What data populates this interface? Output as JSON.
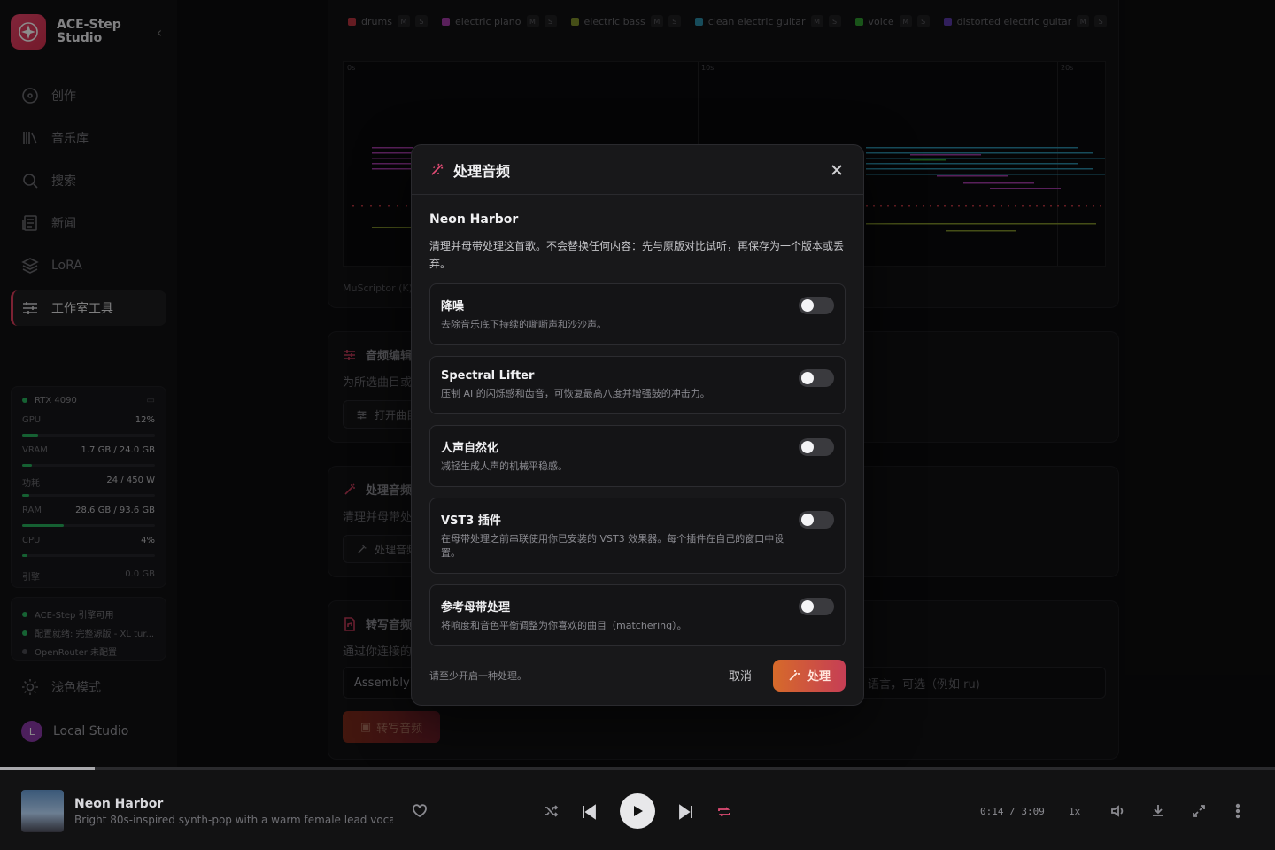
{
  "app": {
    "brand_line1": "ACE-Step",
    "brand_line2": "Studio"
  },
  "nav": [
    {
      "label": "创作",
      "icon": "disc-icon"
    },
    {
      "label": "音乐库",
      "icon": "library-icon"
    },
    {
      "label": "搜索",
      "icon": "search-icon"
    },
    {
      "label": "新闻",
      "icon": "news-icon"
    },
    {
      "label": "LoRA",
      "icon": "layers-icon"
    },
    {
      "label": "工作室工具",
      "icon": "sliders-icon",
      "active": true
    }
  ],
  "hardware": {
    "device": "RTX 4090",
    "rows": [
      {
        "label": "GPU",
        "value": "12%",
        "fill": 0.12
      },
      {
        "label": "VRAM",
        "value": "1.7 GB / 24.0 GB",
        "fill": 0.07
      },
      {
        "label": "功耗",
        "value": "24 / 450 W",
        "fill": 0.05
      },
      {
        "label": "RAM",
        "value": "28.6 GB / 93.6 GB",
        "fill": 0.31
      },
      {
        "label": "CPU",
        "value": "4%",
        "fill": 0.04
      }
    ],
    "engine_label": "引擎",
    "engine_value": "0.0 GB"
  },
  "status": [
    {
      "text": "ACE-Step 引擎可用",
      "ok": true
    },
    {
      "text": "配置就绪: 完整源版 - XL tur...",
      "ok": true
    },
    {
      "text": "OpenRouter 未配置",
      "ok": false
    }
  ],
  "theme_label": "浅色模式",
  "user": {
    "initial": "L",
    "name": "Local Studio"
  },
  "midi": {
    "legend": [
      {
        "name": "drums",
        "color": "#b8333f"
      },
      {
        "name": "electric piano",
        "color": "#a23ba6"
      },
      {
        "name": "electric bass",
        "color": "#7f8e2a"
      },
      {
        "name": "clean electric guitar",
        "color": "#2a8aa6"
      },
      {
        "name": "voice",
        "color": "#2f9a2f"
      },
      {
        "name": "distorted electric guitar",
        "color": "#5a3aa8"
      }
    ],
    "mute_label": "M",
    "solo_label": "S",
    "ticks": [
      "0s",
      "10s",
      "20s"
    ],
    "credit": "MuScriptor (K)"
  },
  "sections": {
    "audio_edit": {
      "title": "音频编辑",
      "desc": "为所选曲目或",
      "button": "打开曲目"
    },
    "process": {
      "title": "处理音频",
      "desc": "清理并母带处",
      "button": "处理音频"
    },
    "transcribe": {
      "title": "转写音频",
      "desc": "通过你连接的",
      "input_value": "Assembly",
      "input_placeholder_right": "语言，可选（例如 ru)",
      "button": "转写音频"
    }
  },
  "modal": {
    "title": "处理音频",
    "song": "Neon Harbor",
    "description": "清理并母带处理这首歌。不会替换任何内容：先与原版对比试听，再保存为一个版本或丢弃。",
    "options": [
      {
        "title": "降噪",
        "desc": "去除音乐底下持续的嘶嘶声和沙沙声。",
        "on": false
      },
      {
        "title": "Spectral Lifter",
        "desc": "压制 AI 的闪烁感和齿音，可恢复最高八度并增强鼓的冲击力。",
        "on": false
      },
      {
        "title": "人声自然化",
        "desc": "减轻生成人声的机械平稳感。",
        "on": false
      },
      {
        "title": "VST3 插件",
        "desc": "在母带处理之前串联使用你已安装的 VST3 效果器。每个插件在自己的窗口中设置。",
        "on": false
      },
      {
        "title": "参考母带处理",
        "desc": "将响度和音色平衡调整为你喜欢的曲目（matchering）。",
        "on": false
      }
    ],
    "hint": "请至少开启一种处理。",
    "cancel": "取消",
    "confirm": "处理"
  },
  "player": {
    "title": "Neon Harbor",
    "subtitle": "Bright 80s-inspired synth-pop with a warm female lead vocal,...",
    "time": "0:14 / 3:09",
    "speed": "1x",
    "progress": 0.074
  }
}
